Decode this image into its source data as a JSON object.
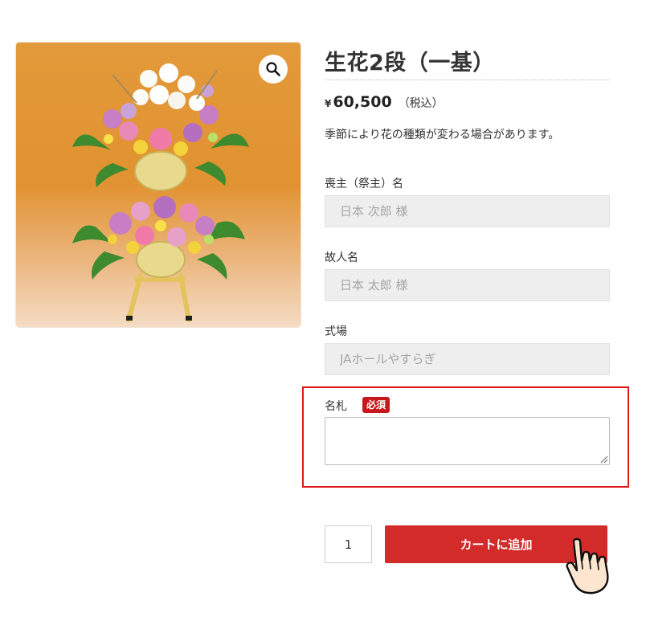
{
  "product": {
    "title": "生花2段（一基）",
    "price_currency": "¥",
    "price_amount": "60,500",
    "price_tax_note": "（税込）",
    "note": "季節により花の種類が変わる場合があります。"
  },
  "form": {
    "mourner_label": "喪主（祭主）名",
    "mourner_placeholder": "日本 次郎 様",
    "deceased_label": "故人名",
    "deceased_placeholder": "日本 太郎 様",
    "venue_label": "式場",
    "venue_placeholder": "JAホールやすらぎ",
    "nafuda_label": "名札",
    "required_badge": "必須",
    "quantity": "1",
    "add_to_cart_label": "カートに追加"
  },
  "icons": {
    "zoom": "magnifier-icon",
    "pointer": "hand-pointer-icon"
  },
  "colors": {
    "accent_red": "#d32a2a",
    "highlight_border": "#e0191c",
    "image_background": "#e39a3a"
  }
}
